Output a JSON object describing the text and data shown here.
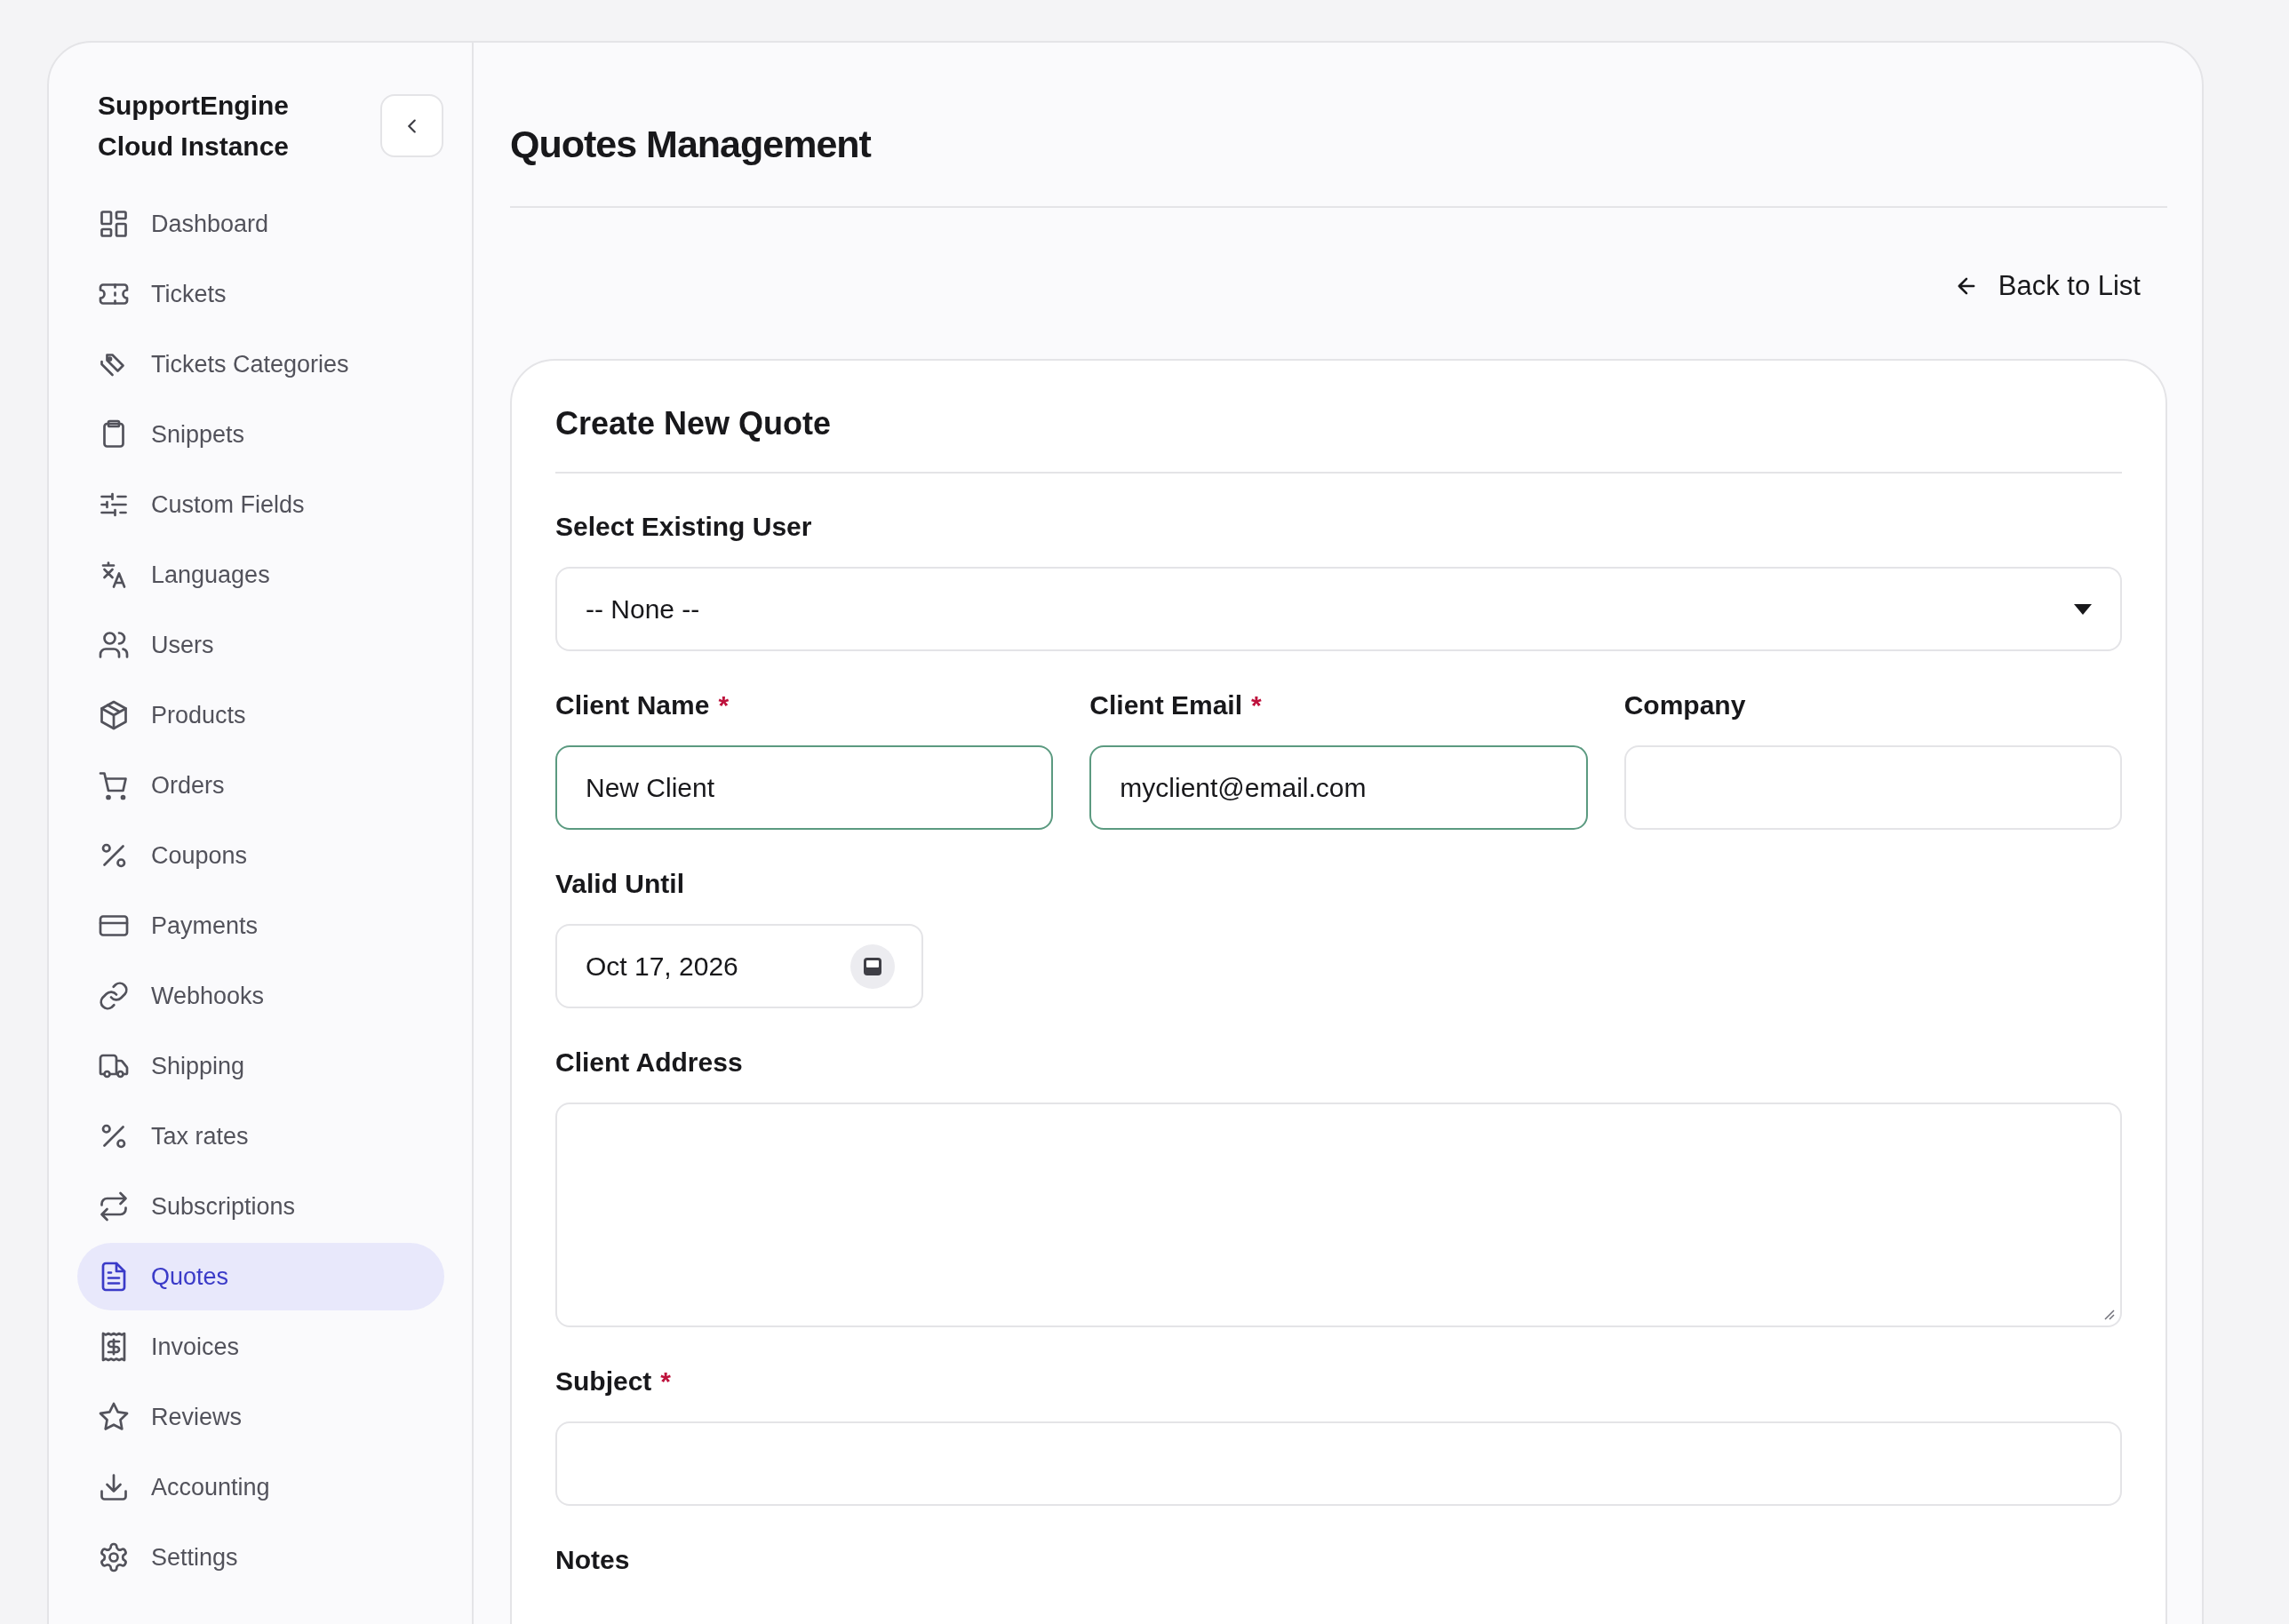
{
  "sidebar": {
    "brand": [
      "SupportEngine",
      "Cloud Instance"
    ],
    "items": [
      {
        "label": "Dashboard",
        "selected": false
      },
      {
        "label": "Tickets",
        "selected": false
      },
      {
        "label": "Tickets Categories",
        "selected": false
      },
      {
        "label": "Snippets",
        "selected": false
      },
      {
        "label": "Custom Fields",
        "selected": false
      },
      {
        "label": "Languages",
        "selected": false
      },
      {
        "label": "Users",
        "selected": false
      },
      {
        "label": "Products",
        "selected": false
      },
      {
        "label": "Orders",
        "selected": false
      },
      {
        "label": "Coupons",
        "selected": false
      },
      {
        "label": "Payments",
        "selected": false
      },
      {
        "label": "Webhooks",
        "selected": false
      },
      {
        "label": "Shipping",
        "selected": false
      },
      {
        "label": "Tax rates",
        "selected": false
      },
      {
        "label": "Subscriptions",
        "selected": false
      },
      {
        "label": "Quotes",
        "selected": true
      },
      {
        "label": "Invoices",
        "selected": false
      },
      {
        "label": "Reviews",
        "selected": false
      },
      {
        "label": "Accounting",
        "selected": false
      },
      {
        "label": "Settings",
        "selected": false
      }
    ]
  },
  "page": {
    "title": "Quotes Management",
    "back_link": "Back to List"
  },
  "form": {
    "title": "Create New Quote",
    "rows": [
      {
        "fields": [
          {
            "kind": "select",
            "label": "Select Existing User",
            "value": "-- None --"
          }
        ]
      },
      {
        "fields": [
          {
            "kind": "text",
            "label": "Client Name",
            "required_mark": "*",
            "value": "New Client",
            "valid": true
          },
          {
            "kind": "text",
            "label": "Client Email",
            "required_mark": "*",
            "value": "myclient@email.com",
            "valid": true
          },
          {
            "kind": "text",
            "label": "Company",
            "valid": false
          }
        ]
      },
      {
        "fields": [
          {
            "kind": "date",
            "label": "Valid Until",
            "value": "Oct 17, 2026"
          }
        ]
      },
      {
        "fields": [
          {
            "kind": "textarea",
            "label": "Client Address"
          }
        ]
      },
      {
        "fields": [
          {
            "kind": "text",
            "label": "Subject",
            "required_mark": "*",
            "valid": false
          }
        ]
      },
      {
        "fields": [
          {
            "kind": "label",
            "label": "Notes"
          }
        ]
      }
    ]
  }
}
